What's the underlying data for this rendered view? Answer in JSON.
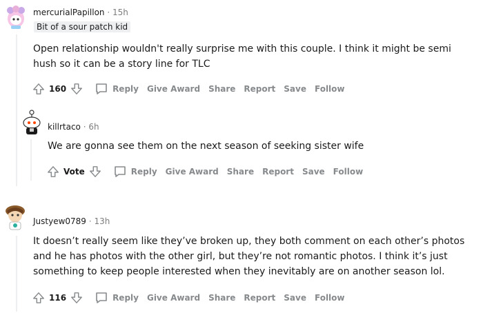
{
  "comments": [
    {
      "author": "mercurialPapillon",
      "sep": "·",
      "time": "15h",
      "flair": "Bit of a sour patch kid",
      "lines": [
        "Open relationship wouldn't really surprise me with this couple. I think it might be semi",
        "hush so it can be a story line for TLC"
      ],
      "score": "160",
      "actions": {
        "reply": "Reply",
        "award": "Give Award",
        "share": "Share",
        "report": "Report",
        "save": "Save",
        "follow": "Follow"
      }
    },
    {
      "author": "killrtaco",
      "sep": "·",
      "time": "6h",
      "lines": [
        "We are gonna see them on the next season of seeking sister wife"
      ],
      "score": "Vote",
      "actions": {
        "reply": "Reply",
        "award": "Give Award",
        "share": "Share",
        "report": "Report",
        "save": "Save",
        "follow": "Follow"
      }
    },
    {
      "author": "Justyew0789",
      "sep": "·",
      "time": "13h",
      "lines": [
        "It doesn’t really seem like they’ve broken up, they both comment on each other’s photos",
        "and he has photos with the other girl, but they’re not romantic photos. I think it’s just",
        "something to keep people interested when they inevitably are on another season lol."
      ],
      "score": "116",
      "actions": {
        "reply": "Reply",
        "award": "Give Award",
        "share": "Share",
        "report": "Report",
        "save": "Save",
        "follow": "Follow"
      }
    }
  ],
  "colors": {
    "text": "#1a1a1b",
    "muted": "#878a8c",
    "thread": "#edeff1"
  },
  "icons": [
    "upvote-icon",
    "downvote-icon",
    "comment-icon",
    "avatar-icon"
  ]
}
